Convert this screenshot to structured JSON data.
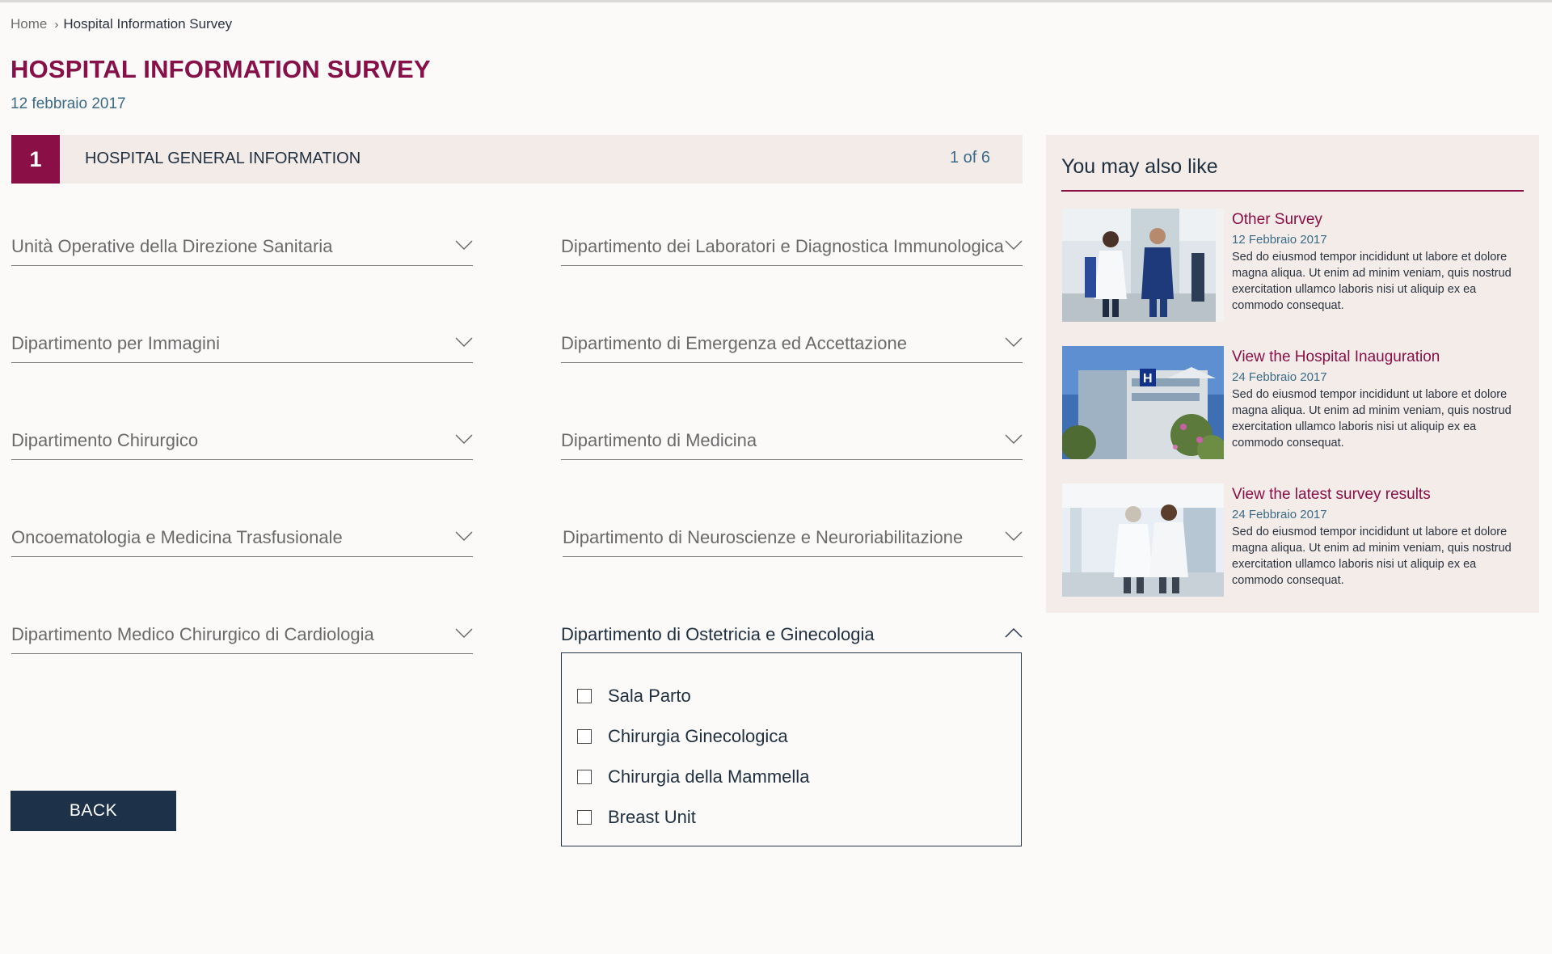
{
  "breadcrumb": {
    "home": "Home",
    "current": "Hospital Information Survey"
  },
  "page": {
    "title": "HOSPITAL INFORMATION SURVEY",
    "date": "12 febbraio 2017"
  },
  "step": {
    "number": "1",
    "title": "HOSPITAL GENERAL INFORMATION",
    "count": "1 of 6"
  },
  "departments": {
    "left": [
      "Unità Operative della Direzione Sanitaria",
      "Dipartimento per Immagini",
      "Dipartimento Chirurgico",
      "Oncoematologia e Medicina Trasfusionale",
      "Dipartimento Medico Chirurgico di Cardiologia"
    ],
    "right": [
      "Dipartimento dei Laboratori e Diagnostica Immunologica",
      "Dipartimento di Emergenza ed Accettazione",
      "Dipartimento di Medicina",
      "Dipartimento di Neuroscienze e Neuroriabilitazione",
      "Dipartimento di Ostetricia e Ginecologia"
    ],
    "open_options": [
      "Sala Parto",
      "Chirurgia Ginecologica",
      "Chirurgia della Mammella",
      "Breast Unit"
    ]
  },
  "back_label": "BACK",
  "sidebar": {
    "title": "You may also like",
    "cards": [
      {
        "title": "Other Survey",
        "date": "12 Febbraio 2017",
        "text": "Sed do eiusmod tempor incididunt ut labore et dolore magna aliqua. Ut enim ad minim veniam, quis nostrud exercitation ullamco laboris nisi ut aliquip ex ea commodo consequat.",
        "image": "doctors-walking-photo"
      },
      {
        "title": "View the Hospital Inauguration",
        "date": "24 Febbraio 2017",
        "text": "Sed do eiusmod tempor incididunt ut labore et dolore magna aliqua. Ut enim ad minim veniam, quis nostrud exercitation ullamco laboris nisi ut aliquip ex ea commodo consequat.",
        "image": "hospital-building-photo"
      },
      {
        "title": "View the latest survey results",
        "date": "24 Febbraio 2017",
        "text": "Sed do eiusmod tempor incididunt ut labore et dolore magna aliqua. Ut enim ad minim veniam, quis nostrud exercitation ullamco laboris nisi ut aliquip ex ea commodo consequat.",
        "image": "doctors-back-photo"
      }
    ]
  },
  "colors": {
    "brand": "#8a0f47",
    "navy": "#1d3249",
    "link": "#3a6b87",
    "panel": "#f3ece9"
  }
}
